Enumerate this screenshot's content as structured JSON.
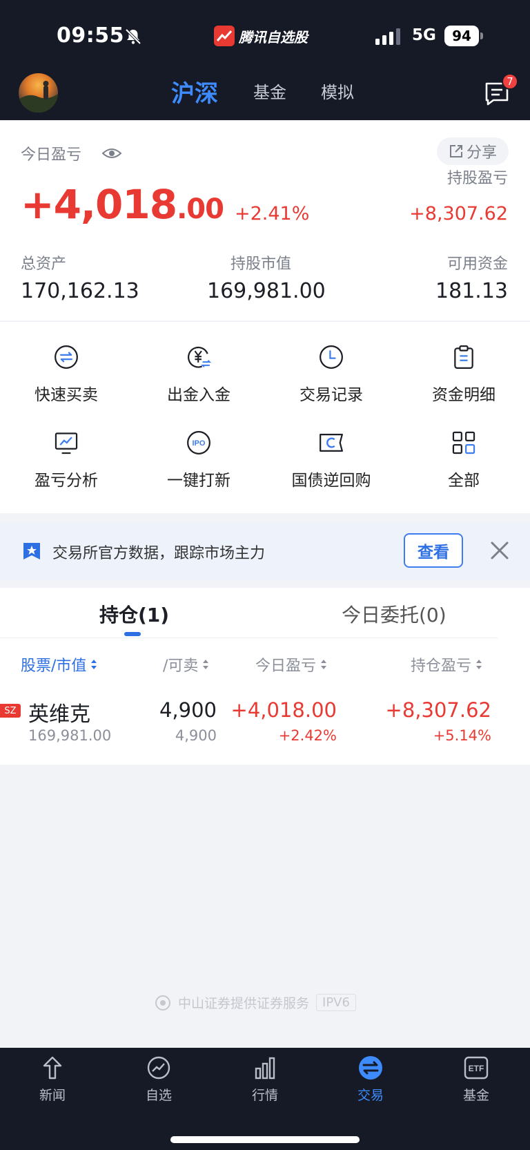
{
  "status_bar": {
    "time": "09:55",
    "app_name": "腾讯自选股",
    "network": "5G",
    "battery": "94"
  },
  "nav": {
    "tabs": [
      {
        "label": "沪深",
        "active": true
      },
      {
        "label": "基金",
        "active": false
      },
      {
        "label": "模拟",
        "active": false
      }
    ],
    "message_badge": "7"
  },
  "summary": {
    "today_pl_label": "今日盈亏",
    "share_label": "分享",
    "today_pl_int": "+4,018",
    "today_pl_dec": ".00",
    "today_pl_pct": "+2.41%",
    "holding_pl_label": "持股盈亏",
    "holding_pl": "+8,307.62",
    "total_assets_label": "总资产",
    "total_assets": "170,162.13",
    "market_value_label": "持股市值",
    "market_value": "169,981.00",
    "available_label": "可用资金",
    "available": "181.13"
  },
  "functions": [
    {
      "label": "快速买卖",
      "icon": "swap-icon"
    },
    {
      "label": "出金入金",
      "icon": "yuan-transfer-icon"
    },
    {
      "label": "交易记录",
      "icon": "clock-icon"
    },
    {
      "label": "资金明细",
      "icon": "clipboard-icon"
    },
    {
      "label": "盈亏分析",
      "icon": "chart-monitor-icon"
    },
    {
      "label": "一键打新",
      "icon": "ipo-icon"
    },
    {
      "label": "国债逆回购",
      "icon": "bond-ticket-icon"
    },
    {
      "label": "全部",
      "icon": "grid-icon"
    }
  ],
  "promo": {
    "text": "交易所官方数据，跟踪市场主力",
    "button": "查看"
  },
  "holdings": {
    "tab_positions": "持仓(1)",
    "tab_orders": "今日委托(0)",
    "columns": [
      "股票/市值",
      "/可卖",
      "今日盈亏",
      "持仓盈亏"
    ],
    "rows": [
      {
        "market": "SZ",
        "name": "英维克",
        "market_value": "169,981.00",
        "qty": "4,900",
        "sellable": "4,900",
        "today_pl": "+4,018.00",
        "today_pl_pct": "+2.42%",
        "holding_pl": "+8,307.62",
        "holding_pl_pct": "+5.14%"
      }
    ]
  },
  "footer_note": {
    "text": "中山证券提供证券服务",
    "tag": "IPV6"
  },
  "tabbar": [
    {
      "label": "新闻",
      "icon": "news-icon",
      "active": false
    },
    {
      "label": "自选",
      "icon": "watchlist-icon",
      "active": false
    },
    {
      "label": "行情",
      "icon": "market-bars-icon",
      "active": false
    },
    {
      "label": "交易",
      "icon": "trade-icon",
      "active": true
    },
    {
      "label": "基金",
      "icon": "etf-icon",
      "active": false
    }
  ],
  "colors": {
    "up": "#e83a33",
    "accent": "#3d8bfd",
    "header_bg": "#151a26"
  }
}
